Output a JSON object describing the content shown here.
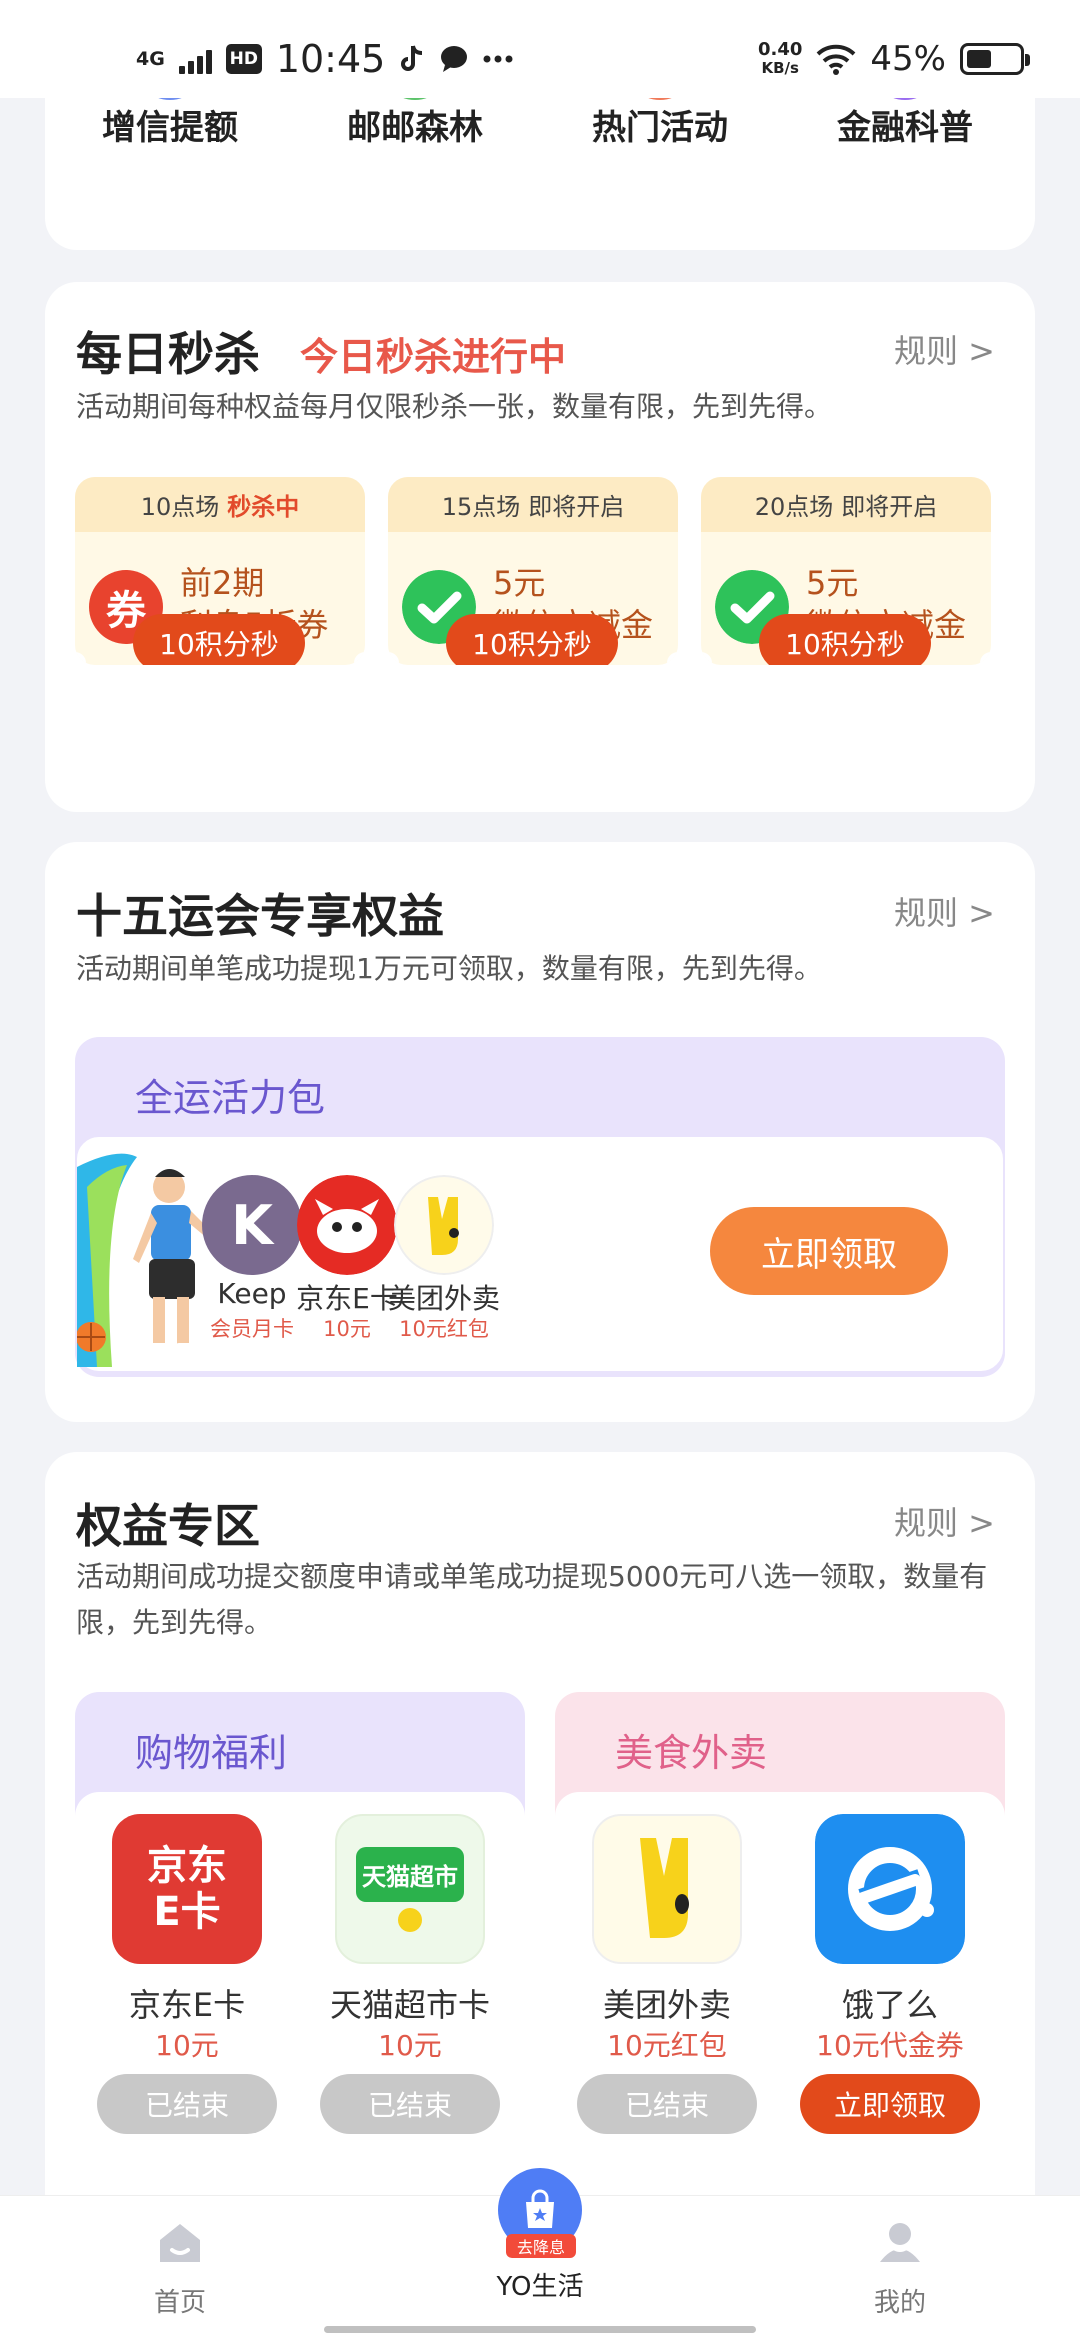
{
  "status_bar": {
    "network": "4G",
    "hd": "HD",
    "time": "10:45",
    "speed_value": "0.40",
    "speed_unit": "KB/s",
    "battery": "45%"
  },
  "quick_links": [
    "增信提额",
    "邮邮森林",
    "热门活动",
    "金融科普"
  ],
  "flash_sale": {
    "title": "每日秒杀",
    "tag": "今日秒杀进行中",
    "rule": "规则 >",
    "desc": "活动期间每种权益每月仅限秒杀一张，数量有限，先到先得。",
    "tickets": [
      {
        "session": "10点场",
        "status": "秒杀中",
        "icon": "coupon-icon",
        "line1": "前2期",
        "line2": "利息5折券",
        "button": "10积分秒"
      },
      {
        "session": "15点场",
        "status": "即将开启",
        "icon": "wechat-icon",
        "line1": "5元",
        "line2": "微信立减金",
        "button": "10积分秒"
      },
      {
        "session": "20点场",
        "status": "即将开启",
        "icon": "wechat-icon",
        "line1": "5元",
        "line2": "微信立减金",
        "button": "10积分秒"
      }
    ],
    "coupon_char": "券"
  },
  "games": {
    "title": "十五运会专享权益",
    "rule": "规则 >",
    "desc": "活动期间单笔成功提现1万元可领取，数量有限，先到先得。",
    "pack_title": "全运活力包",
    "brands": [
      {
        "name": "Keep",
        "sub": "会员月卡",
        "icon": "keep-icon"
      },
      {
        "name": "京东E卡",
        "sub": "10元",
        "icon": "jd-icon"
      },
      {
        "name": "美团外卖",
        "sub": "10元红包",
        "icon": "meituan-icon"
      }
    ],
    "plus": "+",
    "claim_button": "立即领取",
    "keep_letter": "K"
  },
  "benefits": {
    "title": "权益专区",
    "rule": "规则 >",
    "desc": "活动期间成功提交额度申请或单笔成功提现5000元可八选一领取，数量有限，先到先得。",
    "zones": [
      {
        "title": "购物福利",
        "items": [
          {
            "logo_text_1": "京东",
            "logo_text_2": "E卡",
            "name": "京东E卡",
            "value": "10元",
            "button": "已结束",
            "state": "ended"
          },
          {
            "logo_text_1": "天猫超市",
            "logo_text_2": "",
            "name": "天猫超市卡",
            "value": "10元",
            "button": "已结束",
            "state": "ended"
          }
        ]
      },
      {
        "title": "美食外卖",
        "items": [
          {
            "logo_text_1": "",
            "logo_text_2": "",
            "name": "美团外卖",
            "value": "10元红包",
            "button": "已结束",
            "state": "ended"
          },
          {
            "logo_text_1": "",
            "logo_text_2": "",
            "name": "饿了么",
            "value": "10元代金券",
            "button": "立即领取",
            "state": "active"
          }
        ]
      }
    ]
  },
  "tabbar": {
    "home": "首页",
    "center_badge": "去降息",
    "center": "YO生活",
    "mine": "我的"
  },
  "colors": {
    "accent_red": "#e24a1b",
    "accent_orange": "#f5873e",
    "purple": "#6a57cf",
    "pink_title": "#e0618a"
  }
}
